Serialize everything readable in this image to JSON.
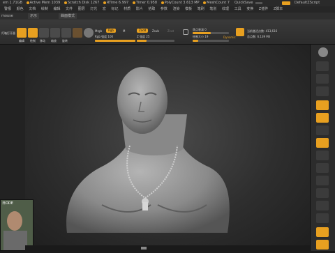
{
  "titlebar": {
    "segments": [
      "em 1.71GB",
      "Active Mem 1039",
      "Scratch Disk 1267",
      "RTime 6.997",
      "Timer 0.958",
      "PolyCount 3.613 MP",
      "MeshCount 7"
    ],
    "quicksave": "QuickSave",
    "script": "DefaultZScript"
  },
  "menubar": {
    "items": [
      "警报",
      "颜色",
      "文档",
      "绘制",
      "编辑",
      "文件",
      "图层",
      "灯光",
      "宏",
      "标记",
      "材质",
      "影片",
      "拾取",
      "参数",
      "渲染",
      "模板",
      "笔刷",
      "笔划",
      "纹理",
      "工具",
      "变换",
      "Z插件",
      "Z脚本"
    ]
  },
  "subbar": {
    "left": "mouse",
    "tab1": "示示",
    "tab2": "曲面模式"
  },
  "shelf": {
    "lightbox": "灯箱打开器",
    "edit": "编辑",
    "draw": "绘制",
    "move": "移动",
    "scale": "缩放",
    "rotate": "旋转",
    "mrgb": "Mrgb",
    "rgb": "Rgb",
    "m": "M",
    "rgb_intensity": "Rgb 强度 100",
    "zadd": "Zadd",
    "zsub": "Zsub",
    "zcut": "Zcut",
    "z_intensity": "Z 强度 25",
    "focal_shift": "焦点衰减 0",
    "draw_size": "绘制大小 19",
    "dynamic": "Dynamic",
    "active_points": "当前激活点数: 413,616",
    "total_points": "总点数: 6.139 Mil"
  },
  "thumbnail": {
    "caption": "日ODE"
  },
  "colors": {
    "accent": "#e8a020",
    "panel": "#2c2c2c",
    "viewport": "#3a3a3a"
  }
}
